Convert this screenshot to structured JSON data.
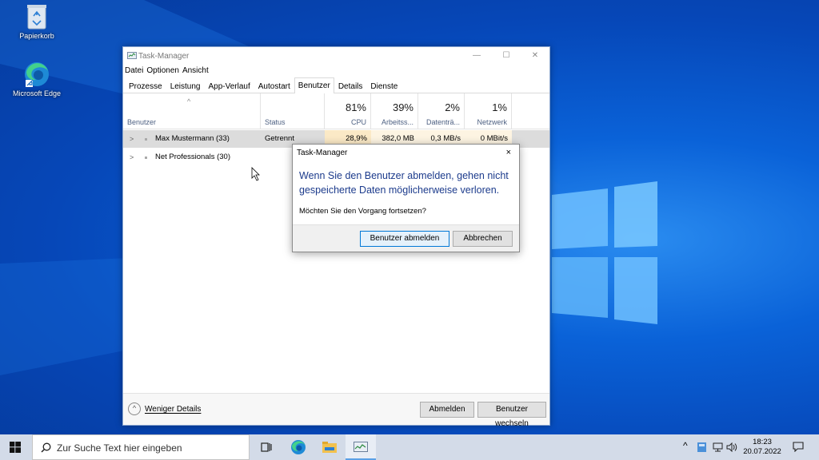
{
  "desktop": {
    "icons": [
      {
        "label": "Papierkorb",
        "icon": "recycle-bin-icon"
      },
      {
        "label": "Microsoft Edge",
        "icon": "edge-icon"
      }
    ]
  },
  "taskmanager": {
    "title": "Task-Manager",
    "menu": [
      "Datei",
      "Optionen",
      "Ansicht"
    ],
    "tabs": [
      "Prozesse",
      "Leistung",
      "App-Verlauf",
      "Autostart",
      "Benutzer",
      "Details",
      "Dienste"
    ],
    "active_tab": "Benutzer",
    "columns": [
      {
        "label": "Benutzer",
        "pct": ""
      },
      {
        "label": "Status",
        "pct": ""
      },
      {
        "label": "CPU",
        "pct": "81%"
      },
      {
        "label": "Arbeitss...",
        "pct": "39%"
      },
      {
        "label": "Datenträ...",
        "pct": "2%"
      },
      {
        "label": "Netzwerk",
        "pct": "1%"
      }
    ],
    "rows": [
      {
        "name": "Max Mustermann (33)",
        "status": "Getrennt",
        "cpu": "28,9%",
        "mem": "382,0 MB",
        "disk": "0,3 MB/s",
        "net": "0 MBit/s"
      },
      {
        "name": "Net Professionals (30)",
        "status": "",
        "cpu": "",
        "mem": "",
        "disk": "",
        "net": ""
      }
    ],
    "footer": {
      "fewer_details": "Weniger Details",
      "logoff": "Abmelden",
      "switch_user": "Benutzer wechseln"
    }
  },
  "dialog": {
    "title": "Task-Manager",
    "close": "×",
    "message": "Wenn Sie den Benutzer abmelden, gehen nicht gespeicherte Daten möglicherweise verloren.",
    "question": "Möchten Sie den Vorgang fortsetzen?",
    "confirm": "Benutzer abmelden",
    "cancel": "Abbrechen"
  },
  "taskbar": {
    "search_placeholder": "Zur Suche Text hier eingeben",
    "time": "18:23",
    "date": "20.07.2022"
  },
  "colors": {
    "accent": "#0078d7",
    "dialog_text": "#1c3b8c",
    "cpu_highlight": "#fdf1d6"
  }
}
